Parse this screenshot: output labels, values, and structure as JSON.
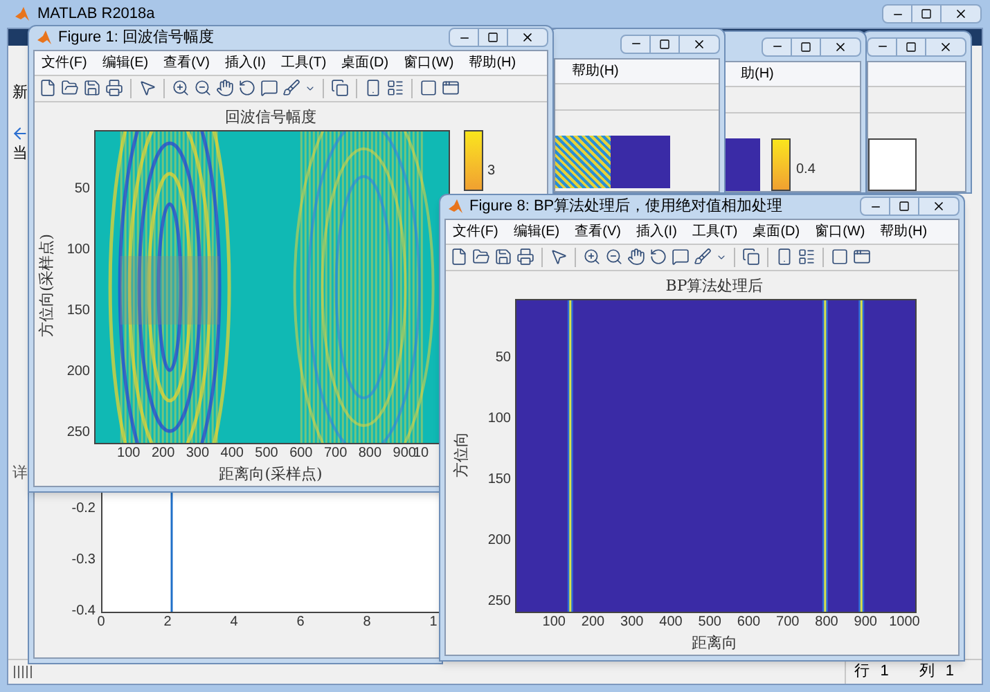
{
  "main_window": {
    "title": "MATLAB R2018a",
    "side_labels": [
      "新",
      "当"
    ],
    "panel_label": "详",
    "status": {
      "row_label": "行",
      "row": "1",
      "col_label": "列",
      "col": "1"
    }
  },
  "background_figures": [
    {
      "kind": "pattern",
      "menu_item": "帮助(H)"
    },
    {
      "kind": "colorbar",
      "menu_item": "助(H)",
      "colorbar_tick": "0.4"
    },
    {
      "kind": "blank"
    }
  ],
  "line_plot": {
    "yticks": [
      "-0.2",
      "-0.3",
      "-0.4"
    ],
    "xticks": [
      "0",
      "2",
      "4",
      "6",
      "8",
      "1"
    ]
  },
  "figures": [
    {
      "title": "Figure 1: 回波信号幅度",
      "menu": [
        "文件(F)",
        "编辑(E)",
        "查看(V)",
        "插入(I)",
        "工具(T)",
        "桌面(D)",
        "窗口(W)",
        "帮助(H)"
      ],
      "plot": {
        "kind": "echo",
        "title": "回波信号幅度",
        "xlabel": "距离向(采样点)",
        "ylabel": "方位向(采样点)",
        "yticks": [
          "50",
          "100",
          "150",
          "200",
          "250"
        ],
        "xticks": [
          "100",
          "200",
          "300",
          "400",
          "500",
          "600",
          "700",
          "800",
          "900",
          "10"
        ],
        "colorbar_tick": "3"
      }
    },
    {
      "title": "Figure 8: BP算法处理后，使用绝对值相加处理",
      "menu": [
        "文件(F)",
        "编辑(E)",
        "查看(V)",
        "插入(I)",
        "工具(T)",
        "桌面(D)",
        "窗口(W)",
        "帮助(H)"
      ],
      "plot": {
        "kind": "bp",
        "title": "BP算法处理后",
        "xlabel": "距离向",
        "ylabel": "方位向",
        "yticks": [
          "50",
          "100",
          "150",
          "200",
          "250"
        ],
        "xticks": [
          "100",
          "200",
          "300",
          "400",
          "500",
          "600",
          "700",
          "800",
          "900",
          "1000"
        ]
      }
    }
  ]
}
